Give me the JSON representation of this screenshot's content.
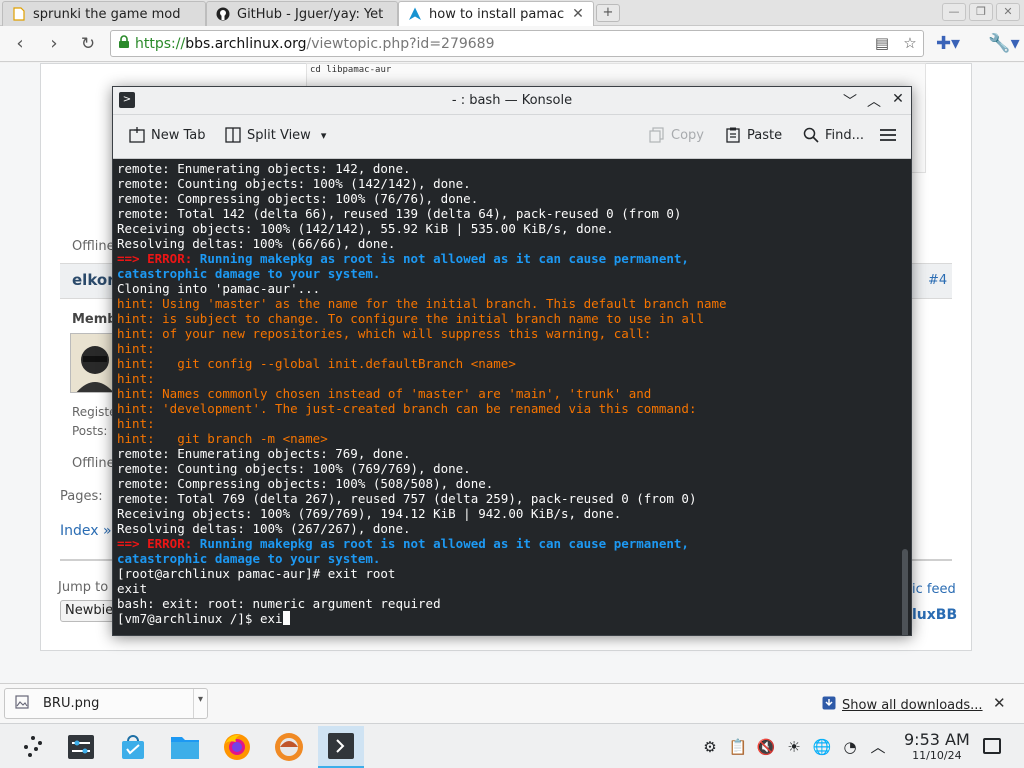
{
  "browser": {
    "tabs": [
      {
        "label": "sprunki the game mod",
        "icon": "document-icon",
        "active": false
      },
      {
        "label": "GitHub - Jguer/yay: Yet",
        "icon": "github-icon",
        "active": false
      },
      {
        "label": "how to install pamac or",
        "icon": "arch-linux-icon",
        "active": true
      }
    ],
    "tab_close": "✕",
    "new_tab": "+",
    "url": {
      "protocol": "https://",
      "host": "bbs.archlinux.org",
      "path": "/viewtopic.php?id=279689"
    }
  },
  "page": {
    "code_snippet": "cd libpamac-aur",
    "offline_1": "Offline",
    "user_name": "elkor",
    "post_number": "#4",
    "member_label": "Memb",
    "registered_label": "Registe",
    "posts_label": "Posts:",
    "offline_2": "Offline",
    "pages_label": "Pages:",
    "index_link": "Index »",
    "jump_to": "Jump to",
    "select_value": "Newbie",
    "feed_link": "ic feed",
    "fluxbb_link": "luxBB"
  },
  "downloads": {
    "file_name": "BRU.png",
    "show_all": "Show all downloads...",
    "close": "✕"
  },
  "konsole": {
    "title": "- : bash — Konsole",
    "toolbar": {
      "new_tab": "New Tab",
      "split_view": "Split View",
      "copy": "Copy",
      "paste": "Paste",
      "find": "Find..."
    },
    "lines": [
      {
        "cls": "c-white",
        "text": "remote: Enumerating objects: 142, done."
      },
      {
        "cls": "c-white",
        "text": "remote: Counting objects: 100% (142/142), done."
      },
      {
        "cls": "c-white",
        "text": "remote: Compressing objects: 100% (76/76), done."
      },
      {
        "cls": "c-white",
        "text": "remote: Total 142 (delta 66), reused 139 (delta 64), pack-reused 0 (from 0)"
      },
      {
        "cls": "c-white",
        "text": "Receiving objects: 100% (142/142), 55.92 KiB | 535.00 KiB/s, done."
      },
      {
        "cls": "c-white",
        "text": "Resolving deltas: 100% (66/66), done."
      },
      {
        "cls": "error",
        "arrow": "==>",
        "word": "ERROR:",
        "text": " Running makepkg as root is not allowed as it can cause permanent,"
      },
      {
        "cls": "c-err-msg",
        "text": "catastrophic damage to your system."
      },
      {
        "cls": "c-white",
        "text": "Cloning into 'pamac-aur'..."
      },
      {
        "cls": "c-orange",
        "text": "hint: Using 'master' as the name for the initial branch. This default branch name"
      },
      {
        "cls": "c-orange",
        "text": "hint: is subject to change. To configure the initial branch name to use in all"
      },
      {
        "cls": "c-orange",
        "text": "hint: of your new repositories, which will suppress this warning, call:"
      },
      {
        "cls": "c-orange",
        "text": "hint:"
      },
      {
        "cls": "c-orange",
        "text": "hint:   git config --global init.defaultBranch <name>"
      },
      {
        "cls": "c-orange",
        "text": "hint:"
      },
      {
        "cls": "c-orange",
        "text": "hint: Names commonly chosen instead of 'master' are 'main', 'trunk' and"
      },
      {
        "cls": "c-orange",
        "text": "hint: 'development'. The just-created branch can be renamed via this command:"
      },
      {
        "cls": "c-orange",
        "text": "hint:"
      },
      {
        "cls": "c-orange",
        "text": "hint:   git branch -m <name>"
      },
      {
        "cls": "c-white",
        "text": "remote: Enumerating objects: 769, done."
      },
      {
        "cls": "c-white",
        "text": "remote: Counting objects: 100% (769/769), done."
      },
      {
        "cls": "c-white",
        "text": "remote: Compressing objects: 100% (508/508), done."
      },
      {
        "cls": "c-white",
        "text": "remote: Total 769 (delta 267), reused 757 (delta 259), pack-reused 0 (from 0)"
      },
      {
        "cls": "c-white",
        "text": "Receiving objects: 100% (769/769), 194.12 KiB | 942.00 KiB/s, done."
      },
      {
        "cls": "c-white",
        "text": "Resolving deltas: 100% (267/267), done."
      },
      {
        "cls": "error",
        "arrow": "==>",
        "word": "ERROR:",
        "text": " Running makepkg as root is not allowed as it can cause permanent,"
      },
      {
        "cls": "c-err-msg",
        "text": "catastrophic damage to your system."
      },
      {
        "cls": "c-white",
        "text": "[root@archlinux pamac-aur]# exit root"
      },
      {
        "cls": "c-white",
        "text": "exit"
      },
      {
        "cls": "c-white",
        "text": "bash: exit: root: numeric argument required"
      },
      {
        "cls": "prompt",
        "text": "[vm7@archlinux /]$ exi"
      }
    ]
  },
  "taskbar": {
    "apps": [
      {
        "name": "application-launcher-icon",
        "active": false
      },
      {
        "name": "system-settings-icon",
        "active": false
      },
      {
        "name": "discover-store-icon",
        "active": false
      },
      {
        "name": "file-manager-icon",
        "active": false
      },
      {
        "name": "firefox-icon",
        "active": false
      },
      {
        "name": "browser-app-icon",
        "active": false
      },
      {
        "name": "konsole-icon",
        "active": true
      }
    ],
    "clock": {
      "time": "9:53 AM",
      "date": "11/10/24"
    }
  },
  "colors": {
    "terminal_bg": "#232629",
    "error_red": "#ed1515",
    "error_blue": "#1d99f3",
    "hint_orange": "#f67400",
    "accent": "#3daee9"
  }
}
